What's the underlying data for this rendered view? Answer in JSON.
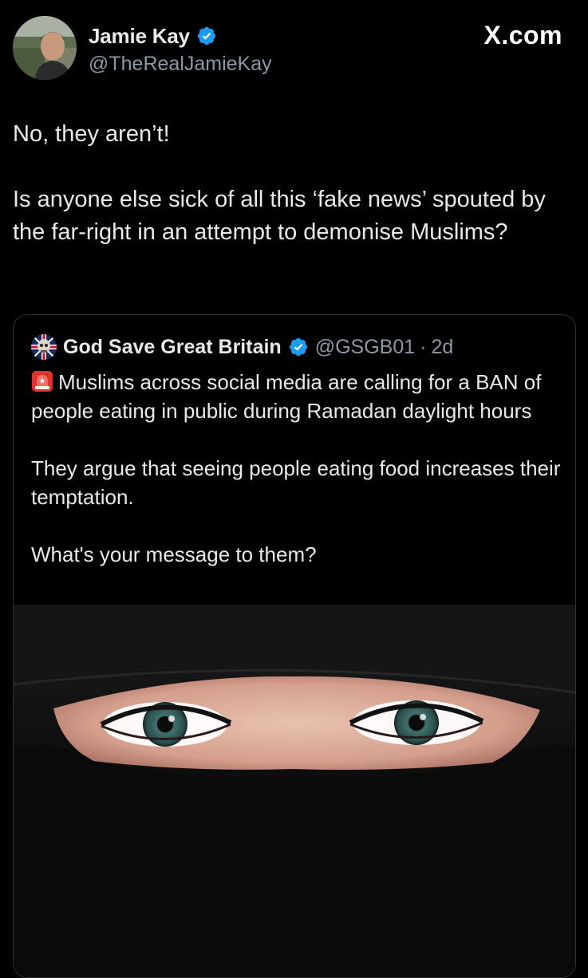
{
  "author": {
    "display_name": "Jamie Kay",
    "handle": "@TheRealJamieKay",
    "verified_icon": "verified-badge-icon"
  },
  "brand": {
    "label": "X.com"
  },
  "tweet": {
    "line1": "No, they aren’t!",
    "line2": "Is anyone else sick of all this ‘fake news’ spouted by the far-right in an attempt to demonise Muslims?"
  },
  "quoted": {
    "display_name": "God Save Great Britain",
    "handle": "@GSGB01",
    "separator": "·",
    "time": "2d",
    "verified_icon": "verified-badge-icon",
    "siren_icon": "rotating-light-emoji",
    "paragraph1": "Muslims across social media are calling for a BAN of people eating in public during Ramadan daylight hours",
    "paragraph2": "They argue that seeing people eating food increases their temptation.",
    "paragraph3": "What's your message to them?"
  },
  "colors": {
    "background": "#000000",
    "text": "#e7e9ea",
    "muted": "#8b98a5",
    "verified_blue": "#1d9bf0",
    "border": "#2f3336"
  }
}
